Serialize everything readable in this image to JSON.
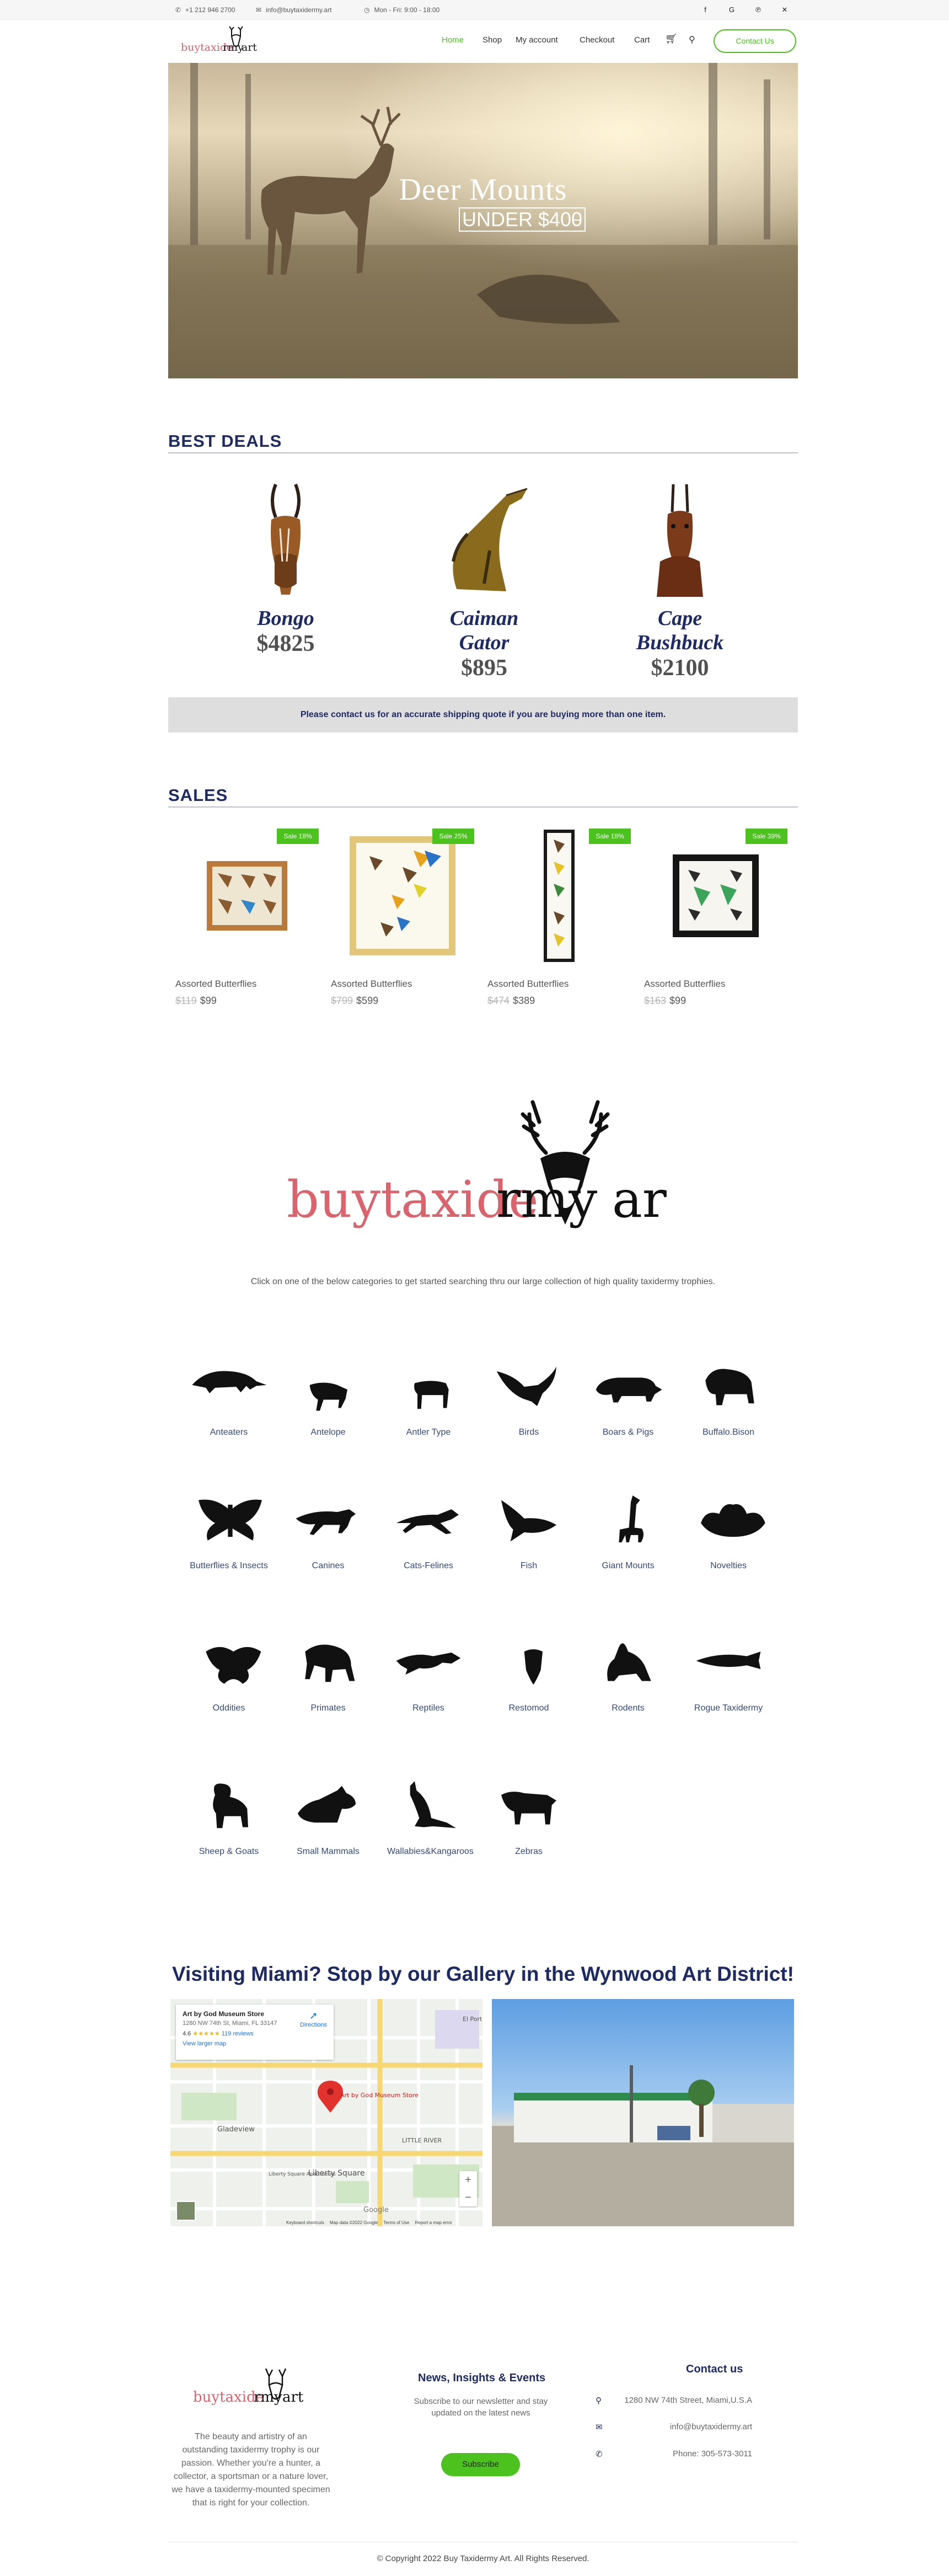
{
  "topbar": {
    "phone": "+1 212 946 2700",
    "email": "info@buytaxidermy.art",
    "hours": "Mon - Fri: 9:00 - 18:00"
  },
  "nav": {
    "logo_text_a": "buytaxide",
    "logo_text_b": "rmy",
    "logo_text_c": "art",
    "items": [
      "Home",
      "Shop",
      "My account",
      "Checkout",
      "Cart"
    ],
    "contact_button": "Contact Us"
  },
  "hero": {
    "title": "Deer Mounts",
    "subtitle": "UNDER $400"
  },
  "best_deals": {
    "title": "BEST DEALS",
    "items": [
      {
        "name": "Bongo",
        "price": "$4825"
      },
      {
        "name": "Caiman Gator",
        "price": "$895"
      },
      {
        "name": "Cape Bushbuck",
        "price": "$2100"
      }
    ],
    "banner": "Please contact us for an accurate shipping quote if you are buying more than one item."
  },
  "sales": {
    "title": "SALES",
    "items": [
      {
        "badge": "Sale 18%",
        "name": "Assorted Butterflies",
        "old_price": "$119",
        "price": "$99"
      },
      {
        "badge": "Sale 25%",
        "name": "Assorted Butterflies",
        "old_price": "$799",
        "price": "$599"
      },
      {
        "badge": "Sale 18%",
        "name": "Assorted Butterflies",
        "old_price": "$474",
        "price": "$389"
      },
      {
        "badge": "Sale 39%",
        "name": "Assorted Butterflies",
        "old_price": "$163",
        "price": "$99"
      }
    ]
  },
  "intro": "Click on one of the below categories to get started searching thru our large collection of high quality taxidermy trophies.",
  "categories": [
    "Anteaters",
    "Antelope",
    "Antler Type",
    "Birds",
    "Boars & Pigs",
    "Buffalo.Bison",
    "Butterflies & Insects",
    "Canines",
    "Cats-Felines",
    "Fish",
    "Giant Mounts",
    "Novelties",
    "Oddities",
    "Primates",
    "Reptiles",
    "Restomod",
    "Rodents",
    "Rogue Taxidermy",
    "Sheep & Goats",
    "Small Mammals",
    "Wallabies&Kangaroos",
    "Zebras"
  ],
  "gallery": {
    "title": "Visiting Miami? Stop by our Gallery in the Wynwood Art District!",
    "map": {
      "place_name": "Art by God Museum Store",
      "address": "1280 NW 74th St, Miami, FL 33147",
      "rating": "4.6",
      "reviews": "119 reviews",
      "larger_map": "View larger map",
      "directions": "Directions",
      "labels": [
        "Gladeview",
        "Liberty Square",
        "LITTLE RIVER",
        "El Portal",
        "Liberty Square Apartments",
        "Art by God Museum Store"
      ],
      "footer": [
        "Keyboard shortcuts",
        "Map data ©2022 Google",
        "Terms of Use",
        "Report a map error"
      ],
      "brand": "Google"
    }
  },
  "footer": {
    "about": "The beauty and artistry of an outstanding taxidermy trophy is our passion. Whether you're a hunter, a collector, a sportsman or a nature lover, we have a taxidermy-mounted specimen that is right for your collection.",
    "news_title": "News, Insights & Events",
    "news_text": "Subscribe to our newsletter and stay updated on the latest news",
    "subscribe": "Subscribe",
    "contact_title": "Contact us",
    "address": "1280 NW 74th Street, Miami,U.S.A",
    "email": "info@buytaxidermy.art",
    "phone": "Phone: 305-573-3011",
    "copyright": "© Copyright 2022 Buy Taxidermy Art. All Rights Reserved."
  },
  "colors": {
    "accent": "#4cc21f",
    "navy": "#1e2a63",
    "logo_red": "#d9646e"
  }
}
